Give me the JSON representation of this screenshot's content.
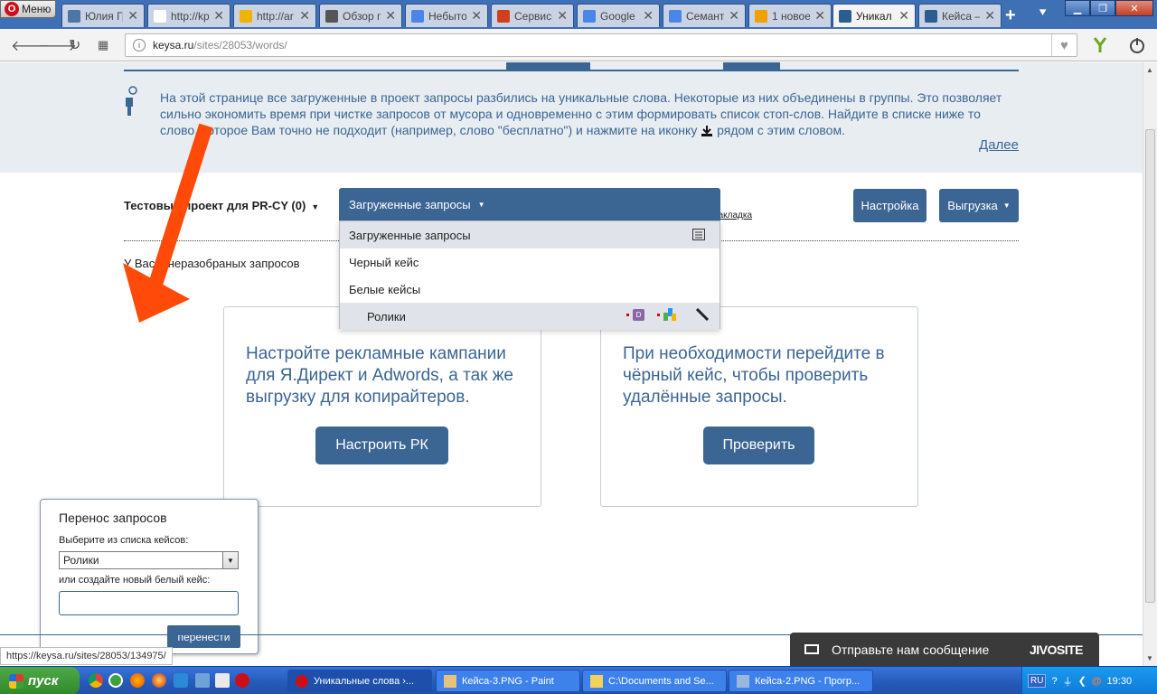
{
  "browser": {
    "menu_label": "Меню",
    "tabs": [
      {
        "label": "Юлия Гр",
        "favicon": "vk-icon",
        "color": "#4a76a8"
      },
      {
        "label": "http://kp",
        "favicon": "yandex-icon",
        "color": "#ffffff"
      },
      {
        "label": "http://ar",
        "favicon": "warning-icon",
        "color": "#f0b400"
      },
      {
        "label": "Обзор г",
        "favicon": "camera-icon",
        "color": "#555555"
      },
      {
        "label": "Небытов",
        "favicon": "doc-icon",
        "color": "#4a86e8"
      },
      {
        "label": "Сервисы",
        "favicon": "us-icon",
        "color": "#d04020"
      },
      {
        "label": "Google Д",
        "favicon": "doc-icon",
        "color": "#4a86e8"
      },
      {
        "label": "Семант",
        "favicon": "doc-icon",
        "color": "#4a86e8"
      },
      {
        "label": "1 новое",
        "favicon": "mail-at-icon",
        "color": "#f0a000"
      },
      {
        "label": "Уникал",
        "favicon": "keysa-icon",
        "color": "#2c5d8f"
      },
      {
        "label": "Кейса –",
        "favicon": "keysa-icon",
        "color": "#2c5d8f"
      }
    ],
    "active_tab_index": 9,
    "url_domain": "keysa.ru",
    "url_path": "/sites/28053/words/"
  },
  "page": {
    "info_text": "На этой странице все загруженные в проект запросы разбились на уникальные слова. Некоторые из них объединены в группы. Это позволяет сильно экономить время при чистке запросов от мусора и одновременно с этим формировать список стоп-слов. Найдите в списке ниже то слово, которое Вам точно не подходит (например, слово \"бесплатно\") и нажмите на иконку",
    "info_text_tail": "рядом с этим словом.",
    "next_link": "Далее",
    "project_name": "Тестовый проект для PR-CY (0)",
    "unsorted_text": "У Вас 0 неразобраных запросов",
    "bookmark_text": "закладка",
    "settings_button": "Настройка",
    "export_button": "Выгрузка",
    "dropdown": {
      "selected": "Загруженные запросы",
      "items": [
        {
          "label": "Загруженные запросы"
        },
        {
          "label": "Черный кейс"
        },
        {
          "label": "Белые кейсы"
        },
        {
          "label": "Ролики"
        }
      ]
    },
    "cards": [
      {
        "text": "Настройте рекламные кампании для Я.Директ и Adwords, а так же выгрузку для копирайтеров.",
        "button": "Настроить РК"
      },
      {
        "text": "При необходимости перейдите в чёрный кейс, чтобы проверить удалённые запросы.",
        "button": "Проверить"
      }
    ],
    "transfer_dialog": {
      "title": "Перенос запросов",
      "select_label": "Выберите из списка кейсов:",
      "selected_case": "Ролики",
      "new_case_label": "или создайте новый белый кейс:",
      "new_case_value": "",
      "submit_button": "перенести"
    },
    "chat": {
      "text": "Отправьте нам сообщение",
      "brand": "JIVOSITE"
    },
    "status_url": "https://keysa.ru/sites/28053/134975/"
  },
  "taskbar": {
    "start_label": "пуск",
    "tasks": [
      {
        "label": "Уникальные слова ›...",
        "active": true
      },
      {
        "label": "Кейса-3.PNG - Paint",
        "active": false
      },
      {
        "label": "C:\\Documents and Se...",
        "active": false
      },
      {
        "label": "Кейса-2.PNG - Прогр...",
        "active": false
      }
    ],
    "lang": "RU",
    "clock": "19:30"
  },
  "colors": {
    "accent": "#3b6593",
    "annotation_arrow": "#ff4a0a"
  }
}
